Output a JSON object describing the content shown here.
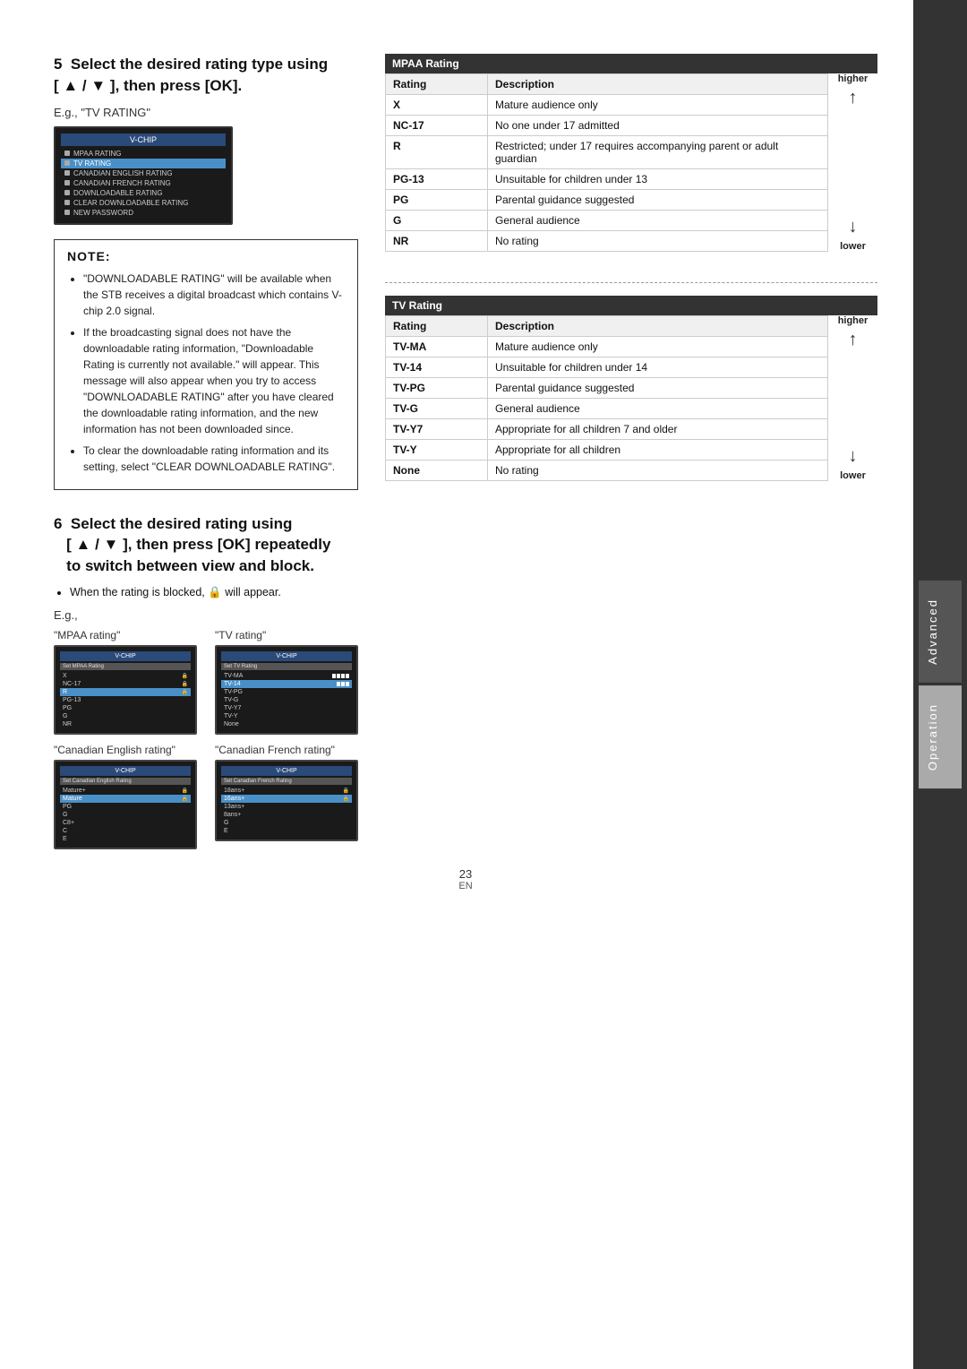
{
  "page": {
    "number": "23",
    "lang": "EN"
  },
  "sidebar": {
    "tabs": [
      "Advanced",
      "Operation"
    ]
  },
  "step5": {
    "heading": "Select the desired rating type using\n[ ▲ / ▼ ], then press [OK].",
    "eg_label": "E.g., \"TV RATING\"",
    "screen": {
      "header": "V-CHIP",
      "items": [
        {
          "label": "MPAA RATING",
          "highlighted": false
        },
        {
          "label": "TV RATING",
          "highlighted": true
        },
        {
          "label": "CANADIAN ENGLISH RATING",
          "highlighted": false
        },
        {
          "label": "CANADIAN FRENCH RATING",
          "highlighted": false
        },
        {
          "label": "DOWNLOADABLE RATING",
          "highlighted": false
        },
        {
          "label": "CLEAR DOWNLOADABLE RATING",
          "highlighted": false
        },
        {
          "label": "NEW PASSWORD",
          "highlighted": false
        }
      ]
    }
  },
  "note": {
    "title": "NOTE:",
    "bullets": [
      "\"DOWNLOADABLE RATING\" will be available when the STB receives a digital broadcast which contains V-chip 2.0 signal.",
      "If the broadcasting signal does not have the downloadable rating information, \"Downloadable Rating is currently not available.\" will appear. This message will also appear when you try to access \"DOWNLOADABLE RATING\" after you have cleared the downloadable rating information, and the new information has not been downloaded since.",
      "To clear the downloadable rating information and its setting, select \"CLEAR DOWNLOADABLE RATING\"."
    ]
  },
  "mpaa_rating": {
    "title": "MPAA Rating",
    "columns": [
      "Rating",
      "Description"
    ],
    "rows": [
      {
        "rating": "X",
        "description": "Mature audience only",
        "level": "highest"
      },
      {
        "rating": "NC-17",
        "description": "No one under 17 admitted",
        "level": ""
      },
      {
        "rating": "R",
        "description": "Restricted; under 17 requires accompanying parent or adult guardian",
        "level": ""
      },
      {
        "rating": "PG-13",
        "description": "Unsuitable for children under 13",
        "level": ""
      },
      {
        "rating": "PG",
        "description": "Parental guidance suggested",
        "level": ""
      },
      {
        "rating": "G",
        "description": "General audience",
        "level": "lowest"
      },
      {
        "rating": "NR",
        "description": "No rating",
        "level": ""
      }
    ],
    "higher_label": "higher",
    "lower_label": "lower"
  },
  "tv_rating": {
    "title": "TV Rating",
    "columns": [
      "Rating",
      "Description"
    ],
    "rows": [
      {
        "rating": "TV-MA",
        "description": "Mature audience only",
        "level": "highest"
      },
      {
        "rating": "TV-14",
        "description": "Unsuitable for children under 14",
        "level": ""
      },
      {
        "rating": "TV-PG",
        "description": "Parental guidance suggested",
        "level": ""
      },
      {
        "rating": "TV-G",
        "description": "General audience",
        "level": ""
      },
      {
        "rating": "TV-Y7",
        "description": "Appropriate for all children 7 and older",
        "level": ""
      },
      {
        "rating": "TV-Y",
        "description": "Appropriate for all children",
        "level": "lowest"
      },
      {
        "rating": "None",
        "description": "No rating",
        "level": ""
      }
    ],
    "higher_label": "higher",
    "lower_label": "lower"
  },
  "step6": {
    "heading": "Select the desired rating using\n[ ▲ / ▼ ], then press [OK] repeatedly\nto switch between view and block.",
    "bullet": "When the rating is blocked, 🔒 will appear.",
    "eg_label": "E.g.,",
    "examples": [
      {
        "caption": "\"MPAA rating\"",
        "screen_header": "V-CHIP",
        "screen_subheader": "Set MPAA Rating",
        "items": [
          {
            "label": "X",
            "locked": true
          },
          {
            "label": "NC-17",
            "locked": true
          },
          {
            "label": "R",
            "locked": true,
            "highlighted": true
          },
          {
            "label": "PG-13",
            "locked": false
          },
          {
            "label": "PG",
            "locked": false
          },
          {
            "label": "G",
            "locked": false
          },
          {
            "label": "NR",
            "locked": false
          }
        ]
      },
      {
        "caption": "\"TV rating\"",
        "screen_header": "V-CHIP",
        "screen_subheader": "Set TV Rating",
        "items": [
          {
            "label": "TV-MA",
            "locked": true
          },
          {
            "label": "TV-14",
            "locked": true,
            "highlighted": true
          },
          {
            "label": "TV-PG",
            "locked": false
          },
          {
            "label": "TV-G",
            "locked": false
          },
          {
            "label": "TV-Y7",
            "locked": false
          },
          {
            "label": "TV-Y",
            "locked": false
          },
          {
            "label": "None",
            "locked": false
          }
        ]
      }
    ],
    "examples2": [
      {
        "caption": "\"Canadian English rating\"",
        "screen_header": "V-CHIP",
        "screen_subheader": "Set Canadian English Rating",
        "items": [
          {
            "label": "Mature+",
            "locked": true
          },
          {
            "label": "Mature",
            "locked": true
          },
          {
            "label": "PG",
            "locked": false
          },
          {
            "label": "G",
            "locked": false
          },
          {
            "label": "C8+",
            "locked": false
          },
          {
            "label": "C",
            "locked": false
          },
          {
            "label": "E",
            "locked": false
          }
        ]
      },
      {
        "caption": "\"Canadian French rating\"",
        "screen_header": "V-CHIP",
        "screen_subheader": "Set Canadian French Rating",
        "items": [
          {
            "label": "18ans+",
            "locked": true
          },
          {
            "label": "16ans+",
            "locked": true
          },
          {
            "label": "13ans+",
            "locked": false
          },
          {
            "label": "8ans+",
            "locked": false
          },
          {
            "label": "G",
            "locked": false
          },
          {
            "label": "E",
            "locked": false
          }
        ]
      }
    ]
  }
}
